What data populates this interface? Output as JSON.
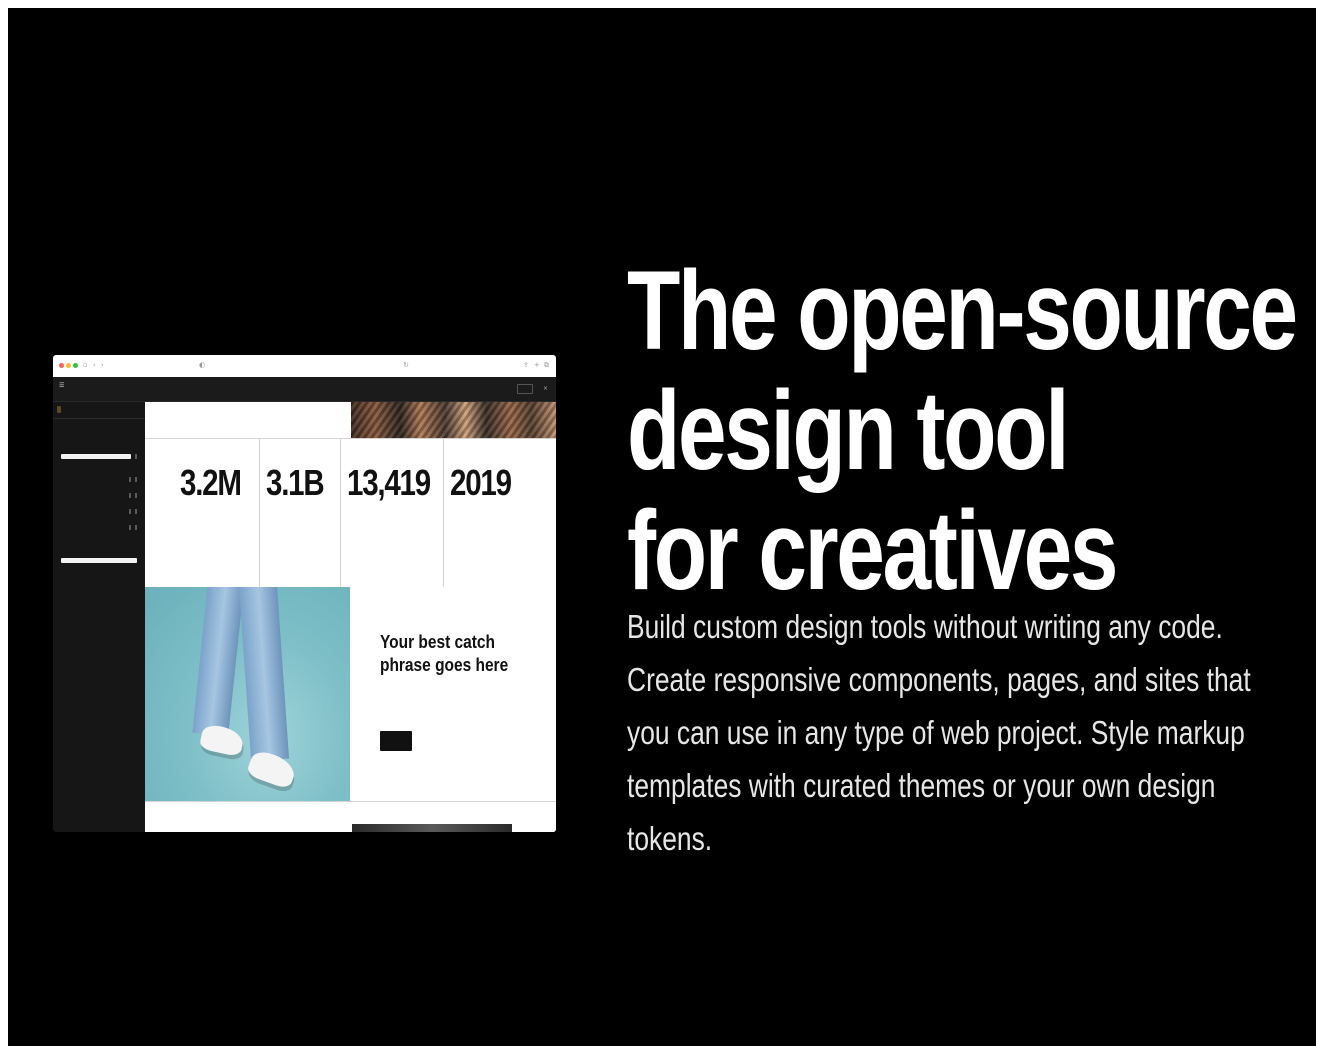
{
  "hero": {
    "headline_lines": [
      "The open-source",
      "design tool",
      "for creatives"
    ],
    "subtext": "Build custom design tools without writing any code. Create responsive components, pages, and sites that you can use in any type of web project. Style markup templates with curated themes or your own design tokens."
  },
  "mock": {
    "stats": [
      {
        "value": "3.2M"
      },
      {
        "value": "3.1B"
      },
      {
        "value": "13,419"
      },
      {
        "value": "2019"
      }
    ],
    "cta": {
      "heading": "Your best catch phrase goes here"
    }
  },
  "colors": {
    "background": "#000000",
    "headline": "#ffffff",
    "subtext": "#e6e6e6",
    "mock_canvas": "#ffffff",
    "mock_sidebar": "#161616",
    "cta_button": "#111111",
    "jeans_photo": "#7fc0c8"
  }
}
